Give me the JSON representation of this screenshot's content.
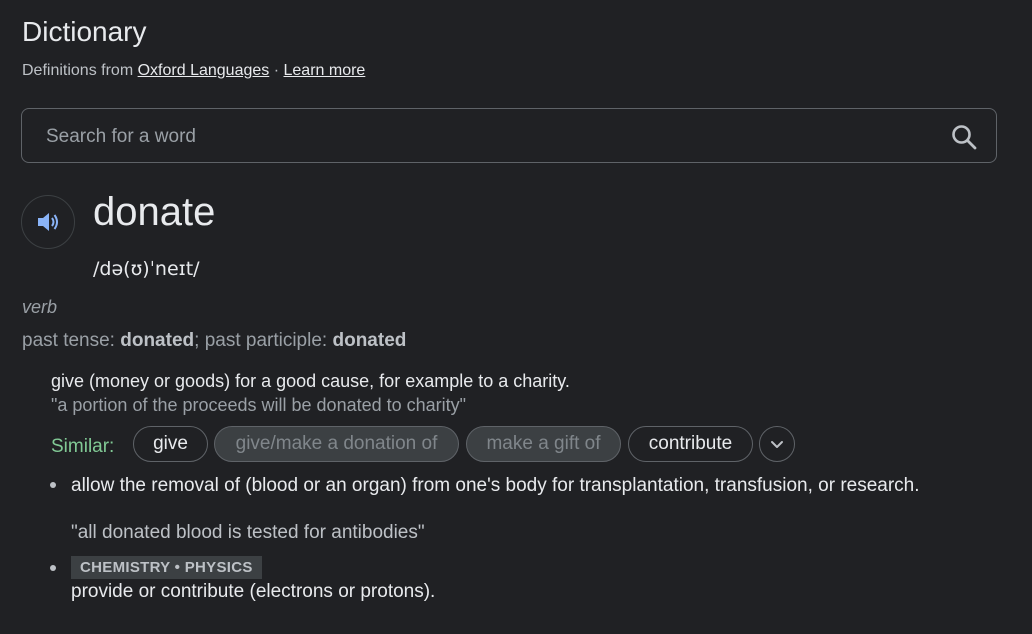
{
  "header": {
    "title": "Dictionary",
    "source_prefix": "Definitions from",
    "source_link": "Oxford Languages",
    "separator": "·",
    "learn_more": "Learn more"
  },
  "search": {
    "placeholder": "Search for a word",
    "icon": "search-icon"
  },
  "entry": {
    "word": "donate",
    "phonetic": "/də(ʊ)ˈneɪt/",
    "part_of_speech": "verb",
    "forms": {
      "past_tense_label": "past tense",
      "past_tense": "donated",
      "past_participle_label": "past participle",
      "past_participle": "donated"
    },
    "senses": [
      {
        "definition": "give (money or goods) for a good cause, for example to a charity.",
        "example": "\"a portion of the proceeds will be donated to charity\"",
        "similar_label": "Similar:",
        "similar": [
          {
            "label": "give",
            "enabled": true
          },
          {
            "label": "give/make a donation of",
            "enabled": false
          },
          {
            "label": "make a gift of",
            "enabled": false
          },
          {
            "label": "contribute",
            "enabled": true
          }
        ]
      },
      {
        "definition": "allow the removal of (blood or an organ) from one's body for transplantation, transfusion, or research.",
        "example": "\"all donated blood is tested for antibodies\""
      },
      {
        "domain_tag": "CHEMISTRY • PHYSICS",
        "definition": "provide or contribute (electrons or protons)."
      }
    ]
  },
  "colors": {
    "background": "#202124",
    "text_primary": "#e8eaed",
    "text_secondary": "#9aa0a6",
    "similar_label": "#81c995",
    "speaker_icon": "#8ab4f8"
  }
}
